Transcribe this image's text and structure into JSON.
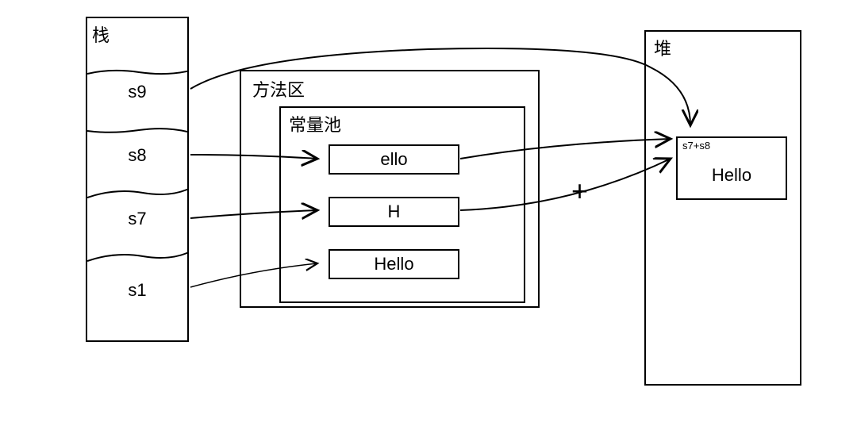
{
  "stack": {
    "title": "栈",
    "cells": [
      "s9",
      "s8",
      "s7",
      "s1"
    ]
  },
  "method_area": {
    "title": "方法区",
    "constant_pool": {
      "title": "常量池",
      "items": [
        "ello",
        "H",
        "Hello"
      ]
    }
  },
  "heap": {
    "title": "堆",
    "object": {
      "label": "s7+s8",
      "value": "Hello"
    }
  },
  "operator": "+"
}
